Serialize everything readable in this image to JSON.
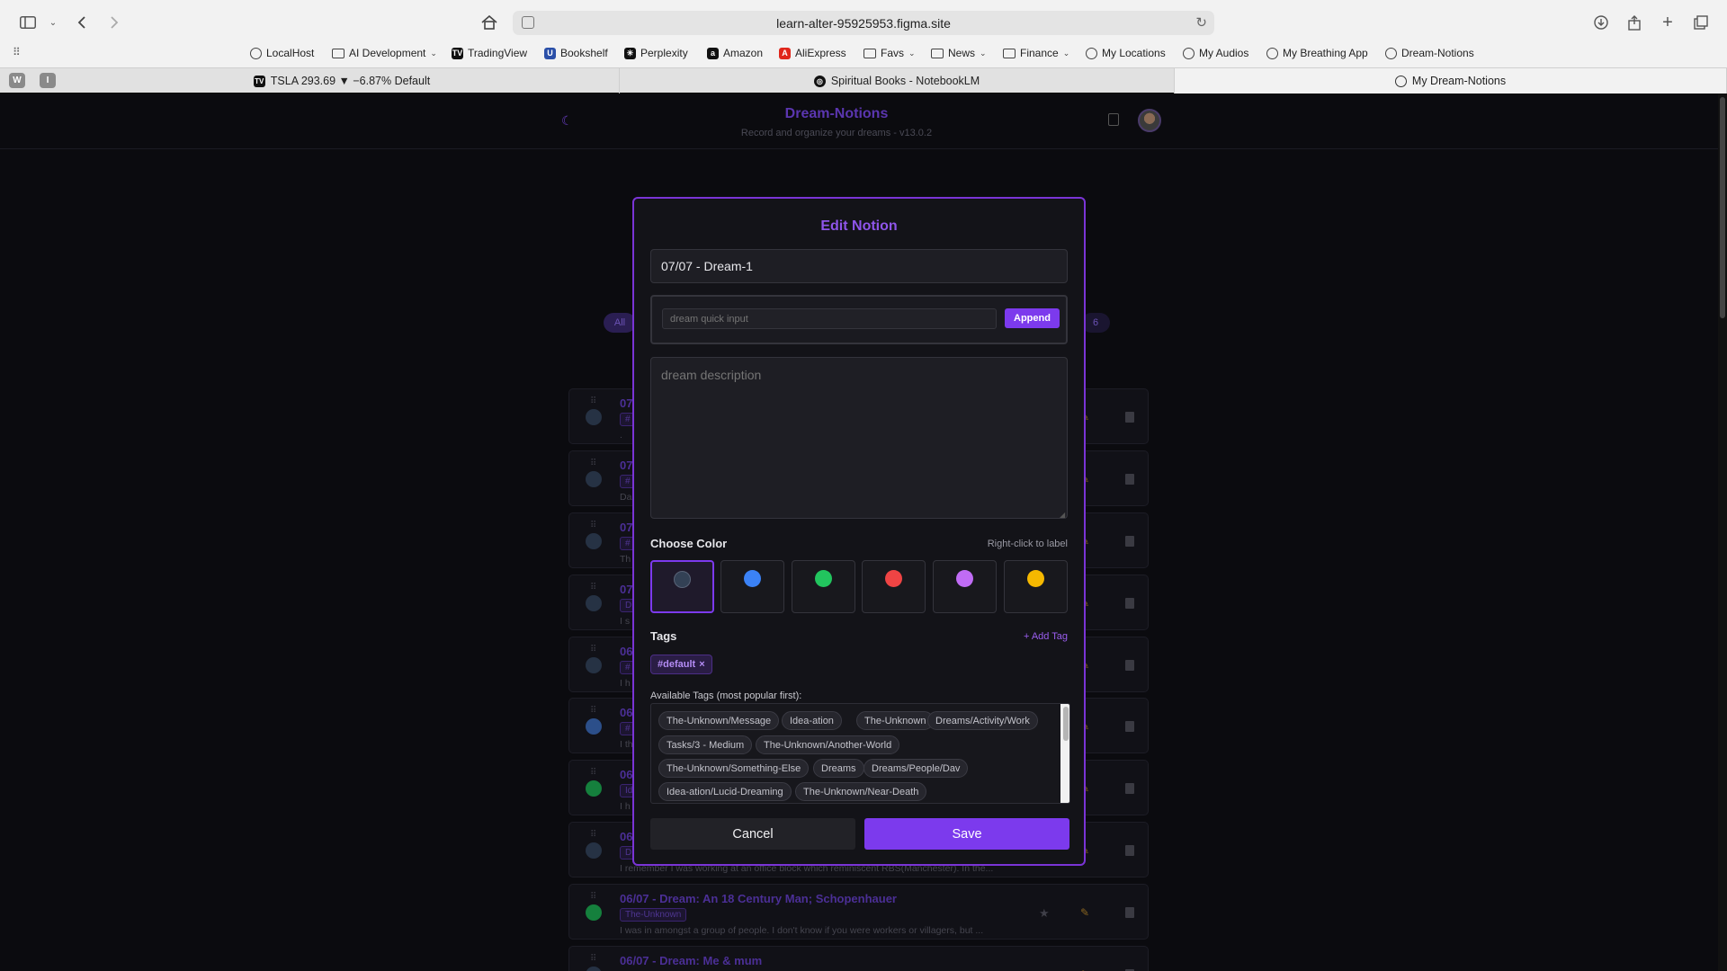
{
  "browser": {
    "url": "learn-alter-95925953.figma.site",
    "bookmarks": [
      {
        "label": "LocalHost",
        "icon": "globe-icon"
      },
      {
        "label": "AI Development",
        "icon": "folder-icon",
        "chevron": true
      },
      {
        "label": "TradingView",
        "icon": "tradingview-icon"
      },
      {
        "label": "Bookshelf",
        "icon": "bookshelf-icon"
      },
      {
        "label": "Perplexity",
        "icon": "perplexity-icon"
      },
      {
        "label": "Amazon",
        "icon": "amazon-icon"
      },
      {
        "label": "AliExpress",
        "icon": "aliexpress-icon"
      },
      {
        "label": "Favs",
        "icon": "folder-icon",
        "chevron": true
      },
      {
        "label": "News",
        "icon": "folder-icon",
        "chevron": true
      },
      {
        "label": "Finance",
        "icon": "folder-icon",
        "chevron": true
      },
      {
        "label": "My Locations",
        "icon": "globe-icon"
      },
      {
        "label": "My Audios",
        "icon": "globe-icon"
      },
      {
        "label": "My Breathing App",
        "icon": "globe-icon"
      },
      {
        "label": "Dream-Notions",
        "icon": "globe-icon"
      }
    ],
    "pinned_tabs": [
      "W",
      "I"
    ],
    "tabs": [
      {
        "label": "TSLA 293.69 ▼ −6.87% Default",
        "icon": "tradingview-icon"
      },
      {
        "label": "Spiritual Books - NotebookLM",
        "icon": "notebooklm-icon"
      },
      {
        "label": "My Dream-Notions",
        "icon": "globe-icon",
        "active": true
      }
    ]
  },
  "app": {
    "title": "Dream-Notions",
    "subtitle": "Record and organize your dreams - v13.0.2",
    "filter_pills": [
      "All",
      "6"
    ],
    "rows": [
      {
        "title": "07",
        "tag": "#",
        "text": "."
      },
      {
        "title": "07",
        "tag": "#",
        "text": "Da"
      },
      {
        "title": "07",
        "tag": "#",
        "text": "Th"
      },
      {
        "title": "07",
        "tag": "D",
        "text": "I s"
      },
      {
        "title": "06",
        "tag": "#",
        "text": "I h"
      },
      {
        "title": "06",
        "tag": "#",
        "text": "I th"
      },
      {
        "title": "06",
        "tag": "Id",
        "text": "I h"
      },
      {
        "title": "06",
        "tag": "D",
        "text": "I remember I was working at an office block which reminiscent RBS(Manchester). In the..."
      },
      {
        "title": "06/07 - Dream: An 18 Century Man; Schopenhauer",
        "tag": "The-Unknown",
        "text": "I was in amongst a group of people. I don't know if you were workers or villagers, but ..."
      },
      {
        "title": "06/07 - Dream: Me & mum",
        "tag": "",
        "text": ""
      }
    ]
  },
  "modal": {
    "title": "Edit Notion",
    "notion_title": "07/07 - Dream-1",
    "quick_input_placeholder": "dream quick input",
    "append_label": "Append",
    "description_placeholder": "dream description",
    "choose_color_label": "Choose Color",
    "right_click_hint": "Right-click to label",
    "colors": [
      "#334155",
      "#3b82f6",
      "#22c55e",
      "#ef4444",
      "#c06cf5",
      "#f5b800"
    ],
    "selected_color_index": 0,
    "tags_label": "Tags",
    "add_tag_label": "+ Add Tag",
    "selected_tags": [
      "#default"
    ],
    "available_tags_label": "Available Tags (most popular first):",
    "available_tags": [
      "The-Unknown/Message",
      "Idea-ation",
      "The-Unknown",
      "Dreams/Activity/Work",
      "Tasks/3 - Medium",
      "The-Unknown/Another-World",
      "The-Unknown/Something-Else",
      "Dreams",
      "Dreams/People/Dav",
      "Idea-ation/Lucid-Dreaming",
      "The-Unknown/Near-Death"
    ],
    "cancel_label": "Cancel",
    "save_label": "Save"
  }
}
